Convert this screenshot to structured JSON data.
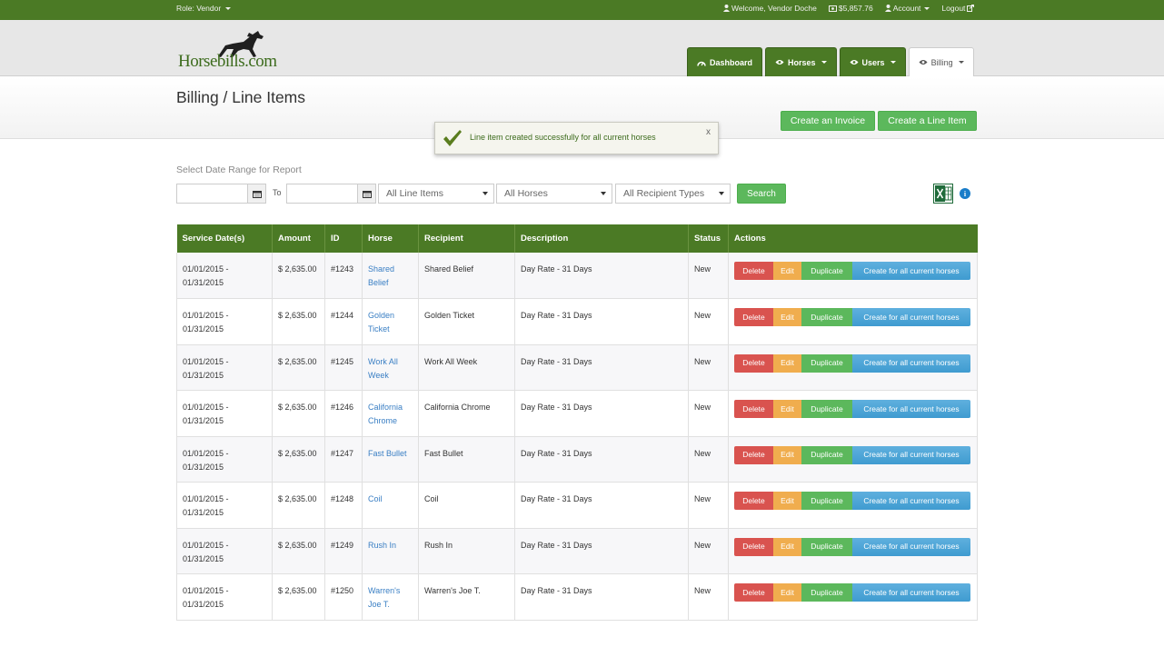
{
  "topbar": {
    "role": "Role: Vendor",
    "welcome": "Welcome, Vendor Doche",
    "balance": "$5,857.76",
    "account": "Account",
    "logout": "Logout"
  },
  "header": {
    "logo_text": "Horsebills.com",
    "nav": [
      {
        "label": "Dashboard",
        "icon": "dashboard-icon"
      },
      {
        "label": "Horses",
        "icon": "eye-icon"
      },
      {
        "label": "Users",
        "icon": "eye-icon"
      },
      {
        "label": "Billing",
        "icon": "eye-icon"
      }
    ]
  },
  "page": {
    "title": "Billing / Line Items",
    "create_invoice": "Create an Invoice",
    "create_line_item": "Create a Line Item"
  },
  "alert": {
    "message": "Line item created successfully for all current horses",
    "close": "x"
  },
  "filter": {
    "label": "Select Date Range for Report",
    "from_value": "",
    "to_label": "To",
    "to_value": "",
    "line_items": "All Line Items",
    "horses": "All Horses",
    "recipient_types": "All Recipient Types",
    "search": "Search"
  },
  "table": {
    "headers": [
      "Service Date(s)",
      "Amount",
      "ID",
      "Horse",
      "Recipient",
      "Description",
      "Status",
      "Actions"
    ],
    "actions": {
      "delete": "Delete",
      "edit": "Edit",
      "duplicate": "Duplicate",
      "create_all": "Create for all current horses"
    },
    "rows": [
      {
        "date1": "01/01/2015 -",
        "date2": "01/31/2015",
        "amount": "$ 2,635.00",
        "id": "#1243",
        "horse1": "Shared",
        "horse2": "Belief",
        "recipient": "Shared Belief",
        "description": "Day Rate - 31 Days",
        "status": "New"
      },
      {
        "date1": "01/01/2015 -",
        "date2": "01/31/2015",
        "amount": "$ 2,635.00",
        "id": "#1244",
        "horse1": "Golden",
        "horse2": "Ticket",
        "recipient": "Golden Ticket",
        "description": "Day Rate - 31 Days",
        "status": "New"
      },
      {
        "date1": "01/01/2015 -",
        "date2": "01/31/2015",
        "amount": "$ 2,635.00",
        "id": "#1245",
        "horse1": "Work All",
        "horse2": "Week",
        "recipient": "Work All Week",
        "description": "Day Rate - 31 Days",
        "status": "New"
      },
      {
        "date1": "01/01/2015 -",
        "date2": "01/31/2015",
        "amount": "$ 2,635.00",
        "id": "#1246",
        "horse1": "California",
        "horse2": "Chrome",
        "recipient": "California Chrome",
        "description": "Day Rate - 31 Days",
        "status": "New"
      },
      {
        "date1": "01/01/2015 -",
        "date2": "01/31/2015",
        "amount": "$ 2,635.00",
        "id": "#1247",
        "horse1": "Fast Bullet",
        "horse2": "",
        "recipient": "Fast Bullet",
        "description": "Day Rate - 31 Days",
        "status": "New"
      },
      {
        "date1": "01/01/2015 -",
        "date2": "01/31/2015",
        "amount": "$ 2,635.00",
        "id": "#1248",
        "horse1": "Coil",
        "horse2": "",
        "recipient": "Coil",
        "description": "Day Rate - 31 Days",
        "status": "New"
      },
      {
        "date1": "01/01/2015 -",
        "date2": "01/31/2015",
        "amount": "$ 2,635.00",
        "id": "#1249",
        "horse1": "Rush In",
        "horse2": "",
        "recipient": "Rush In",
        "description": "Day Rate - 31 Days",
        "status": "New"
      },
      {
        "date1": "01/01/2015 -",
        "date2": "01/31/2015",
        "amount": "$ 2,635.00",
        "id": "#1250",
        "horse1": "Warren's",
        "horse2": "Joe T.",
        "recipient": "Warren's Joe T.",
        "description": "Day Rate - 31 Days",
        "status": "New"
      }
    ]
  },
  "colors": {
    "brand_green": "#4b7a25",
    "success_green": "#5cb85c",
    "danger": "#d9534f",
    "warning": "#f0ad4e",
    "info": "#5bc0de",
    "link": "#3a7fc4"
  }
}
